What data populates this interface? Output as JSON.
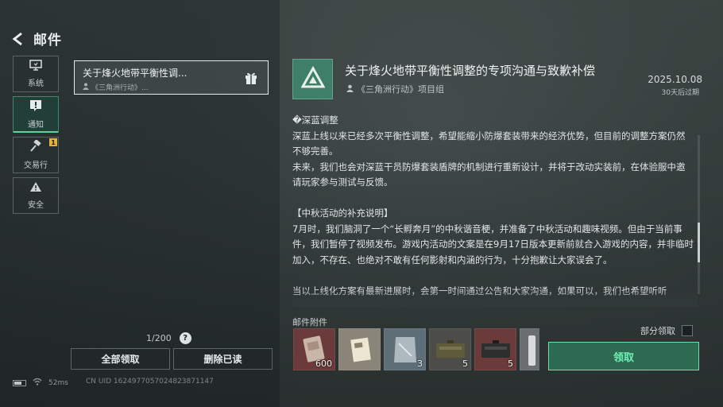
{
  "header": {
    "title": "邮件"
  },
  "nav": {
    "items": [
      {
        "label": "系统",
        "icon": "monitor-icon"
      },
      {
        "label": "通知",
        "icon": "alert-box-icon",
        "active": true
      },
      {
        "label": "交易行",
        "icon": "hammer-icon",
        "badge": "1"
      },
      {
        "label": "安全",
        "icon": "warning-triangle-icon"
      }
    ]
  },
  "mail_list": {
    "items": [
      {
        "title": "关于烽火地带平衡性调...",
        "sender": "《三角洲行动》..."
      }
    ],
    "pager": "1/200",
    "claim_all": "全部领取",
    "delete_read": "删除已读"
  },
  "status": {
    "ping": "52ms",
    "uid": "CN UID 1624977057024823871147"
  },
  "mail": {
    "title": "关于烽火地带平衡性调整的专项沟通与致歉补偿",
    "sender": "《三角洲行动》项目组",
    "date": "2025.10.08",
    "expire": "30天后过期",
    "paragraphs": [
      "�深蓝调整",
      "深蓝上线以来已经多次平衡性调整，希望能缩小防爆套装带来的经济优势，但目前的调整方案仍然不够完善。",
      "未来，我们也会对深蓝干员防爆套装盾牌的机制进行重新设计，并将于改动实装前，在体验服中邀请玩家参与测试与反馈。",
      " ",
      "【中秋活动的补充说明】",
      "7月时，我们脑洞了一个“长孵奔月”的中秋谐音梗，并准备了中秋活动和趣味视频。但由于当前事件，我们暂停了视频发布。游戏内活动的文案是在9月17日版本更新前就合入游戏的内容，并非临时加入，不存在、也绝对不敢有任何影射和内涵的行为，十分抱歉让大家误会了。",
      " ",
      "当以上线化方案有最新进展时，会第一时间通过公告和大家沟通，如果可以，我们也希望听听"
    ],
    "attachments_label": "邮件附件",
    "partial_claim": "部分领取",
    "claim": "领取",
    "attachments": [
      {
        "icon": "ration-pack-icon",
        "qty": "600",
        "bg": "#6b3a3a"
      },
      {
        "icon": "document-card-icon",
        "qty": "",
        "bg": "#8a8578"
      },
      {
        "icon": "plastic-bag-icon",
        "qty": "3",
        "bg": "#5e6e78"
      },
      {
        "icon": "ammo-crate-icon",
        "qty": "5",
        "bg": "#4c4c48"
      },
      {
        "icon": "ammo-case-icon",
        "qty": "5",
        "bg": "#6b3a3a"
      },
      {
        "icon": "tube-icon",
        "qty": "",
        "bg": "#6b6e70"
      }
    ]
  }
}
